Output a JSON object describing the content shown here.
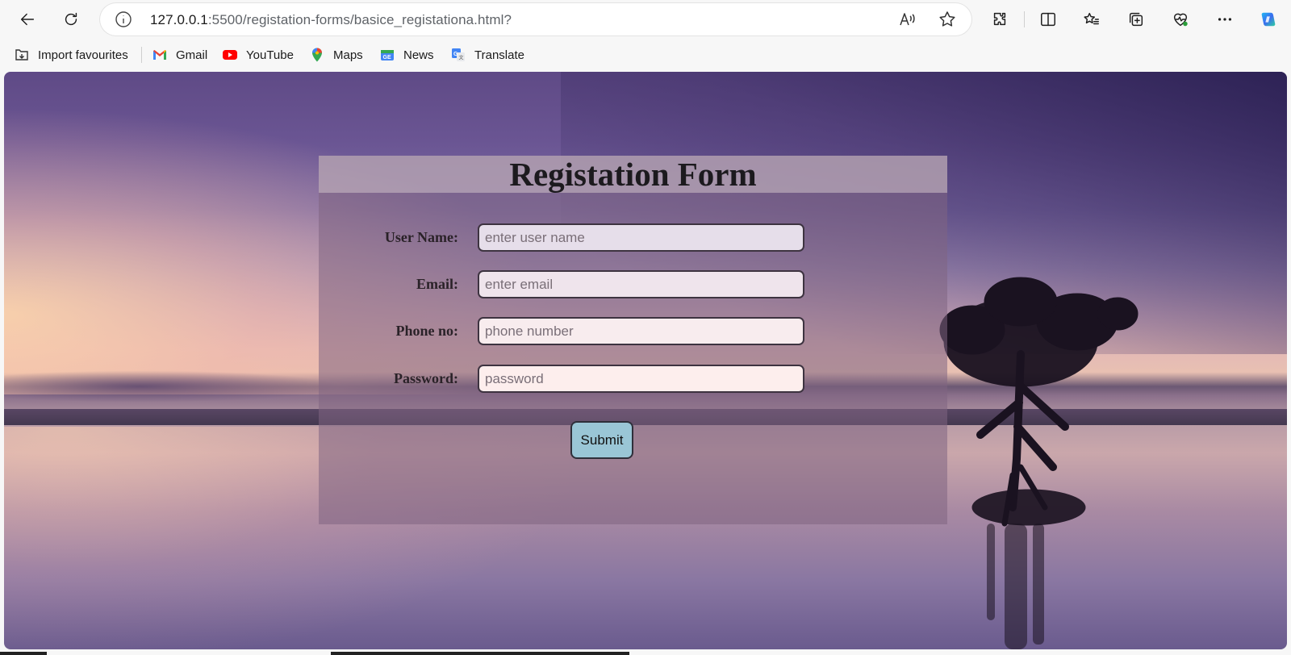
{
  "browser": {
    "url_host": "127.0.0.1",
    "url_rest": ":5500/registation-forms/basice_registationa.html?",
    "bookmarks": [
      {
        "label": "Import favourites",
        "icon": "import-icon"
      },
      {
        "label": "Gmail",
        "icon": "gmail-icon"
      },
      {
        "label": "YouTube",
        "icon": "youtube-icon"
      },
      {
        "label": "Maps",
        "icon": "maps-icon"
      },
      {
        "label": "News",
        "icon": "news-icon"
      },
      {
        "label": "Translate",
        "icon": "translate-icon"
      }
    ]
  },
  "form": {
    "title": "Registation Form",
    "fields": [
      {
        "label": "User Name:",
        "placeholder": "enter user name",
        "value": ""
      },
      {
        "label": "Email:",
        "placeholder": "enter email",
        "value": ""
      },
      {
        "label": "Phone no:",
        "placeholder": "phone number",
        "value": ""
      },
      {
        "label": "Password:",
        "placeholder": "password",
        "value": ""
      }
    ],
    "submit_label": "Submit"
  },
  "colors": {
    "submit_button": "#9ac6d6",
    "form_overlay": "#80648c"
  }
}
